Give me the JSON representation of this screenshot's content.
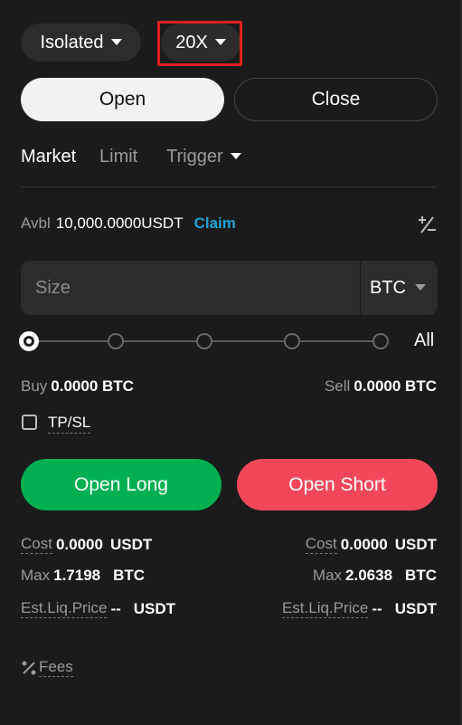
{
  "header": {
    "margin_mode": "Isolated",
    "leverage": "20X"
  },
  "direction_tabs": {
    "open": "Open",
    "close": "Close"
  },
  "order_types": {
    "market": "Market",
    "limit": "Limit",
    "trigger": "Trigger"
  },
  "balance": {
    "label": "Avbl",
    "value": "10,000.0000USDT",
    "claim": "Claim"
  },
  "size": {
    "placeholder": "Size",
    "unit": "BTC"
  },
  "slider": {
    "all_label": "All",
    "percent": 0
  },
  "amounts": {
    "buy_label": "Buy",
    "buy_value": "0.0000 BTC",
    "sell_label": "Sell",
    "sell_value": "0.0000 BTC"
  },
  "tpsl": {
    "label": "TP/SL",
    "checked": false
  },
  "actions": {
    "long": "Open Long",
    "short": "Open Short",
    "long_color": "#00b050",
    "short_color": "#f2475a"
  },
  "long_info": {
    "cost_label": "Cost",
    "cost_value": "0.0000",
    "cost_unit": "USDT",
    "max_label": "Max",
    "max_value": "1.7198",
    "max_unit": "BTC",
    "liq_label": "Est.Liq.Price",
    "liq_value": "--",
    "liq_unit": "USDT"
  },
  "short_info": {
    "cost_label": "Cost",
    "cost_value": "0.0000",
    "cost_unit": "USDT",
    "max_label": "Max",
    "max_value": "2.0638",
    "max_unit": "BTC",
    "liq_label": "Est.Liq.Price",
    "liq_value": "--",
    "liq_unit": "USDT"
  },
  "footer": {
    "fees": "Fees"
  },
  "icons": {
    "transfer": "plus-minus-icon",
    "fees": "percent-icon"
  }
}
